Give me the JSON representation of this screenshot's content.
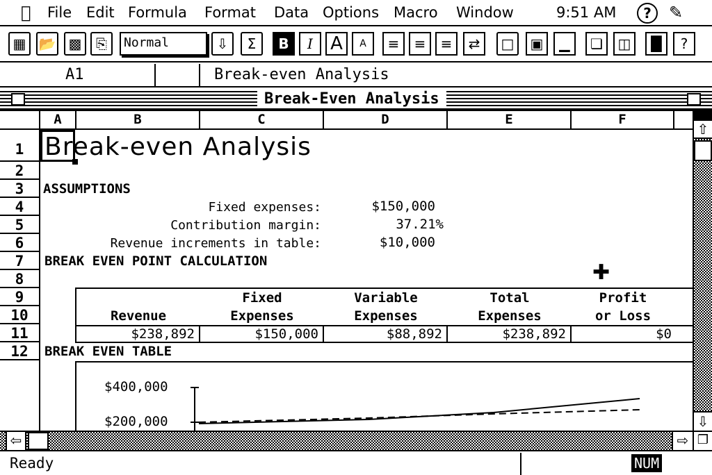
{
  "menubar": {
    "items": [
      "File",
      "Edit",
      "Formula",
      "Format",
      "Data",
      "Options",
      "Macro",
      "Window"
    ],
    "clock": "9:51 AM"
  },
  "toolbar": {
    "style_value": "Normal"
  },
  "formula_bar": {
    "cell_ref": "A1",
    "content": "Break-even Analysis"
  },
  "window": {
    "title": "Break-Even Analysis"
  },
  "columns": [
    "A",
    "B",
    "C",
    "D",
    "E",
    "F"
  ],
  "rows": [
    "1",
    "2",
    "3",
    "4",
    "5",
    "6",
    "7",
    "8",
    "9",
    "10",
    "11",
    "12"
  ],
  "sheet": {
    "title": "Break-even Analysis",
    "assumptions_heading": "ASSUMPTIONS",
    "assumptions": [
      {
        "label": "Fixed expenses:",
        "value": "$150,000"
      },
      {
        "label": "Contribution margin:",
        "value": "37.21%"
      },
      {
        "label": "Revenue increments in table:",
        "value": "$10,000"
      }
    ],
    "calc_heading": "BREAK EVEN POINT CALCULATION",
    "calc_table": {
      "headers": [
        [
          "",
          "Revenue"
        ],
        [
          "Fixed",
          "Expenses"
        ],
        [
          "Variable",
          "Expenses"
        ],
        [
          "Total",
          "Expenses"
        ],
        [
          "Profit",
          "or Loss"
        ]
      ],
      "values": [
        "$238,892",
        "$150,000",
        "$88,892",
        "$238,892",
        "$0"
      ]
    },
    "table_heading": "BREAK EVEN TABLE"
  },
  "chart_data": {
    "type": "line",
    "title": "",
    "ytick_labels": [
      "$400,000",
      "$200,000"
    ]
  },
  "status": {
    "text": "Ready",
    "indicator": "NUM"
  }
}
